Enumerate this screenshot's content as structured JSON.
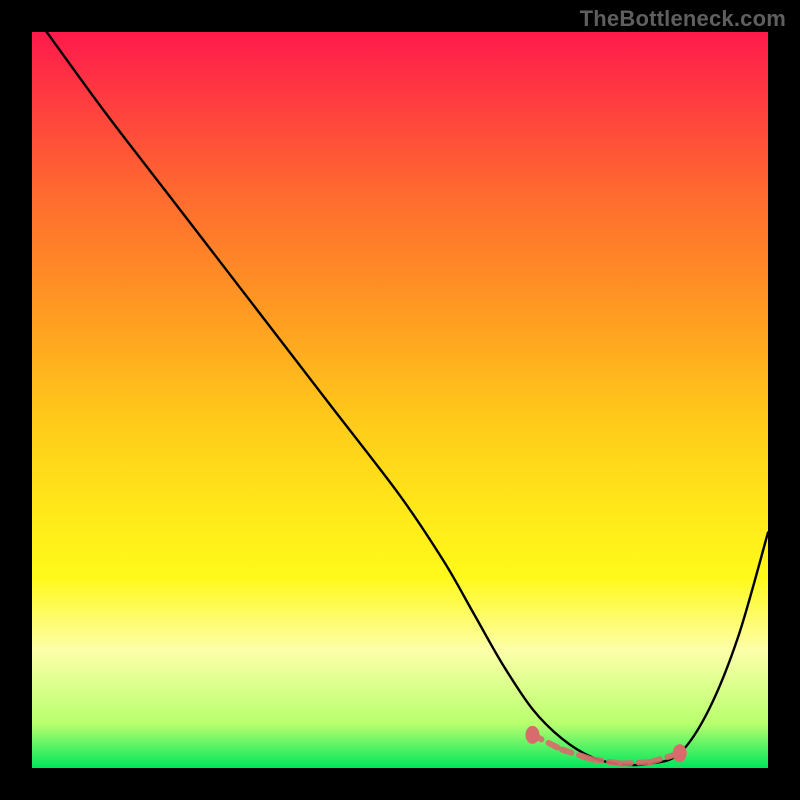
{
  "watermark": "TheBottleneck.com",
  "chart_data": {
    "type": "line",
    "title": "",
    "xlabel": "",
    "ylabel": "",
    "xlim": [
      0,
      100
    ],
    "ylim": [
      0,
      100
    ],
    "series": [
      {
        "name": "curve",
        "x": [
          2,
          10,
          20,
          30,
          40,
          50,
          56,
          60,
          64,
          68,
          72,
          76,
          80,
          84,
          88,
          92,
          96,
          100
        ],
        "y": [
          100,
          89,
          76,
          63,
          50,
          37,
          28,
          21,
          14,
          8,
          4,
          1.5,
          0.5,
          0.6,
          2,
          8,
          18,
          32
        ]
      }
    ],
    "markers": {
      "name": "highlight-band",
      "color": "#d86b6b",
      "x": [
        68,
        72,
        76,
        80,
        84,
        88
      ],
      "y": [
        4.5,
        2.5,
        1.2,
        0.6,
        0.8,
        2
      ]
    },
    "gradient_stops": [
      {
        "pos": 0.0,
        "color": "#ff1a4b"
      },
      {
        "pos": 0.1,
        "color": "#ff3f3f"
      },
      {
        "pos": 0.22,
        "color": "#ff6a2f"
      },
      {
        "pos": 0.38,
        "color": "#ff9a22"
      },
      {
        "pos": 0.52,
        "color": "#ffc81a"
      },
      {
        "pos": 0.64,
        "color": "#ffe61a"
      },
      {
        "pos": 0.74,
        "color": "#fff91a"
      },
      {
        "pos": 0.84,
        "color": "#fdffa9"
      },
      {
        "pos": 0.94,
        "color": "#b8ff6e"
      },
      {
        "pos": 1.0,
        "color": "#00e65c"
      }
    ]
  }
}
